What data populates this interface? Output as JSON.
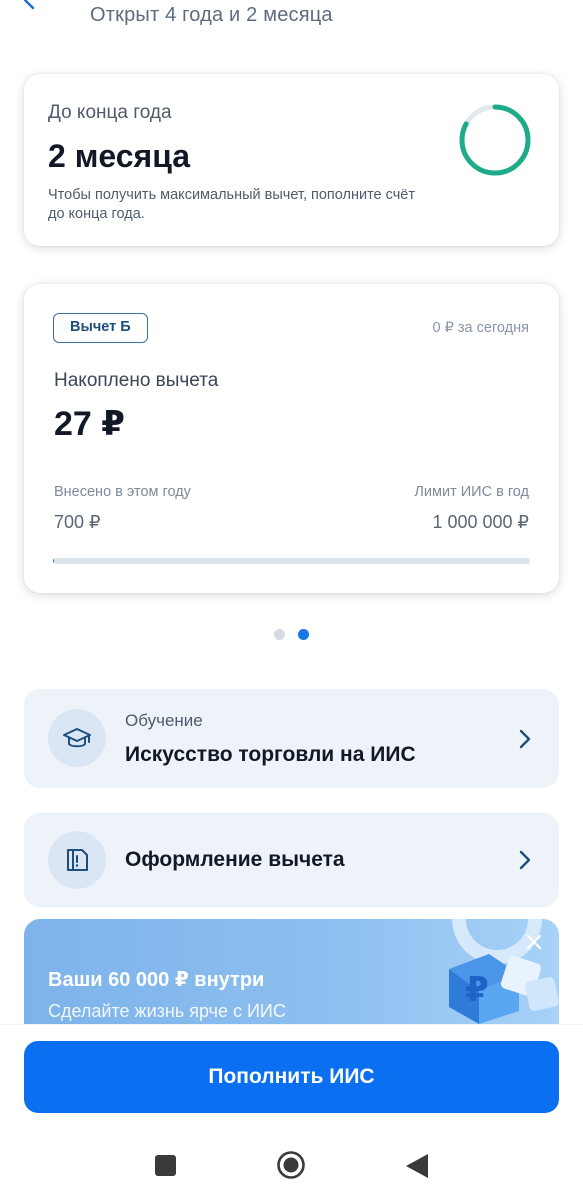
{
  "header": {
    "opened_text": "Открыт 4 года и 2 месяца"
  },
  "year_card": {
    "label": "До конца года",
    "value": "2 месяца",
    "hint": "Чтобы получить максимальный вычет, пополните счёт до конца года.",
    "ring_fraction": 0.83,
    "ring_color": "#1faa8a"
  },
  "deduction_card": {
    "badge": "Вычет Б",
    "today": "0 ₽  за сегодня",
    "accumulated_label": "Накоплено вычета",
    "accumulated_value": "27 ₽",
    "contributed_label": "Внесено в этом году",
    "contributed_value": "700 ₽",
    "limit_label": "Лимит ИИС в год",
    "limit_value": "1 000 000 ₽",
    "progress_fraction": 0.0007
  },
  "pager": {
    "count": 2,
    "active": 2
  },
  "education_link": {
    "subtitle": "Обучение",
    "title": "Искусство торговли на ИИС",
    "icon": "graduation-cap-icon"
  },
  "deduction_link": {
    "title": "Оформление вычета",
    "icon": "document-icon"
  },
  "promo": {
    "title": "Ваши 60 000 ₽ внутри",
    "subtitle": "Сделайте жизнь ярче с ИИС"
  },
  "primary_action": {
    "label": "Пополнить ИИС"
  },
  "colors": {
    "accent": "#0a6ff0",
    "card_link_bg": "#eef3fa"
  }
}
